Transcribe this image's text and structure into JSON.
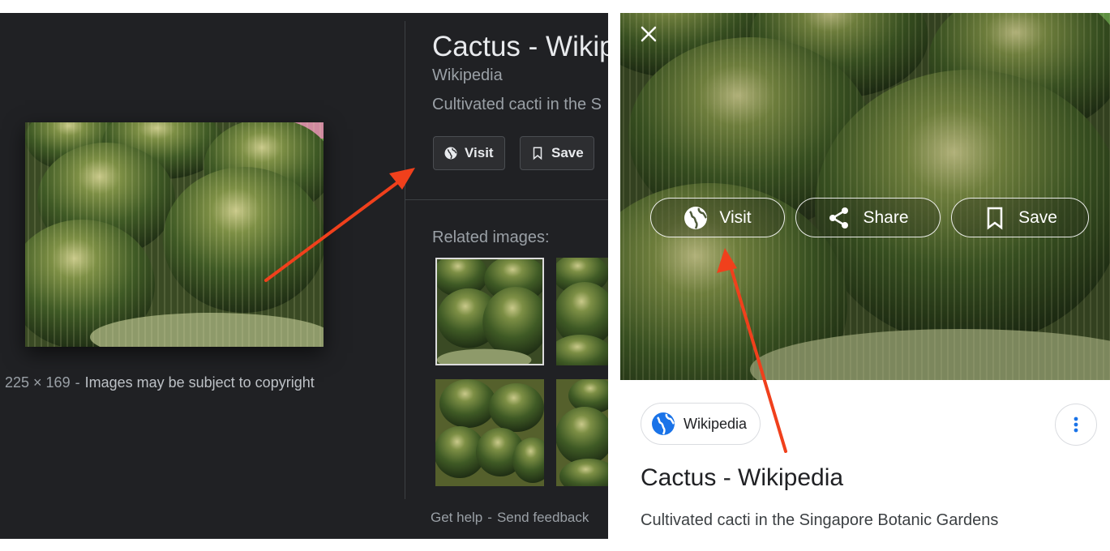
{
  "desktop": {
    "image_dimensions": "225 × 169",
    "copyright_notice": "Images may be subject to copyright",
    "title": "Cactus - Wikip",
    "source": "Wikipedia",
    "description": "Cultivated cacti in the S",
    "visit_label": "Visit",
    "save_label": "Save",
    "related_label": "Related images:",
    "get_help": "Get help",
    "send_feedback": "Send feedback"
  },
  "mobile": {
    "visit_label": "Visit",
    "share_label": "Share",
    "save_label": "Save",
    "source_chip": "Wikipedia",
    "title": "Cactus - Wikipedia",
    "description": "Cultivated cacti in the Singapore Botanic Gardens"
  },
  "colors": {
    "dark_bg": "#202124",
    "annotation_arrow": "#f0401c",
    "link_blue": "#1a73e8"
  },
  "icons": [
    "globe-icon",
    "bookmark-icon",
    "share-icon",
    "close-icon",
    "more-vert-icon"
  ]
}
